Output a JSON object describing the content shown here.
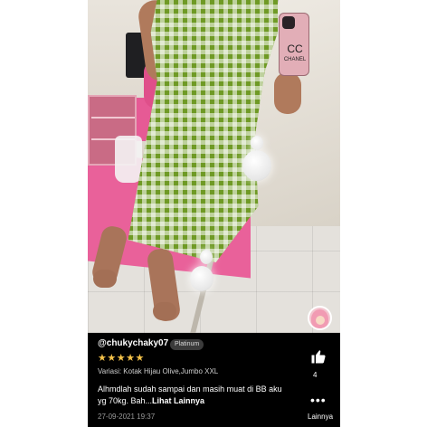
{
  "photo": {
    "phone_case_logo": "CC",
    "phone_case_text": "CHANEL"
  },
  "review": {
    "username": "@chukychaky07",
    "badge": "Platinum",
    "rating_stars": "★★★★★",
    "rating": 5,
    "variant": "Variasi: Kotak Hijau Olive,Jumbo XXL",
    "text": "Alhmdlah sudah sampai dan masih muat di BB aku yg 70kg. Bah...",
    "more_link": "Lihat Lainnya",
    "date": "27-09-2021 19:37"
  },
  "actions": {
    "like_icon": "thumbs-up-icon",
    "like_count": "4",
    "more_icon": "more-dots-icon",
    "more_label": "Lainnya"
  },
  "colors": {
    "panel_bg": "#000000",
    "star": "#f6c34a",
    "badge_bg": "#3b3b3b"
  }
}
